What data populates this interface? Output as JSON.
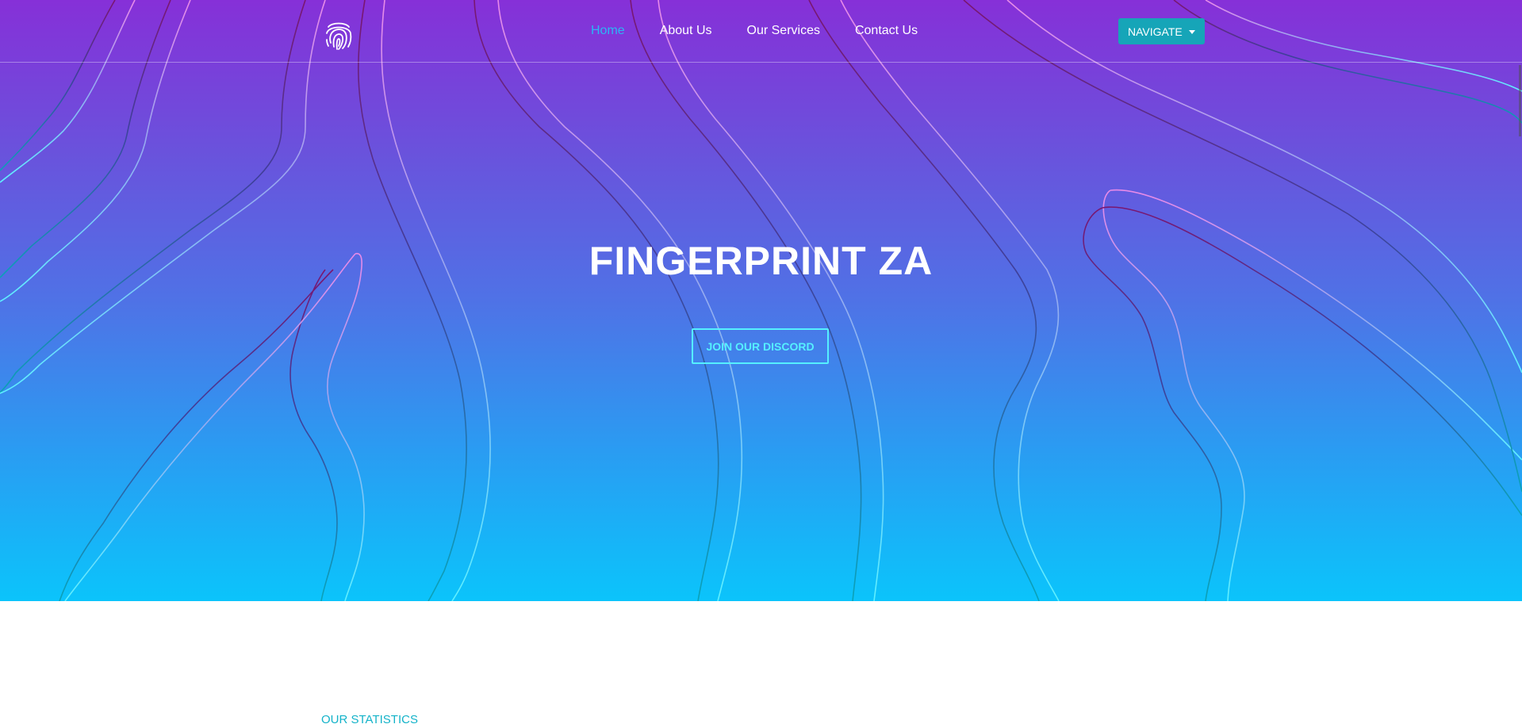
{
  "header": {
    "logo_icon": "fingerprint-icon",
    "nav_links": [
      {
        "label": "Home",
        "active": true
      },
      {
        "label": "About Us",
        "active": false
      },
      {
        "label": "Our Services",
        "active": false
      },
      {
        "label": "Contact Us",
        "active": false
      }
    ],
    "dropdown_label": "NAVIGATE"
  },
  "hero": {
    "title": "FINGERPRINT ZA",
    "cta_label": "JOIN OUR DISCORD"
  },
  "statistics": {
    "section_label": "OUR STATISTICS"
  },
  "colors": {
    "gradient_top": "#8630d8",
    "gradient_bottom": "#0bc4fb",
    "active_link": "#2bb6f5",
    "dropdown_bg": "#16a5b8",
    "cta_border": "#55f0ff",
    "section_label": "#14b3c9"
  }
}
